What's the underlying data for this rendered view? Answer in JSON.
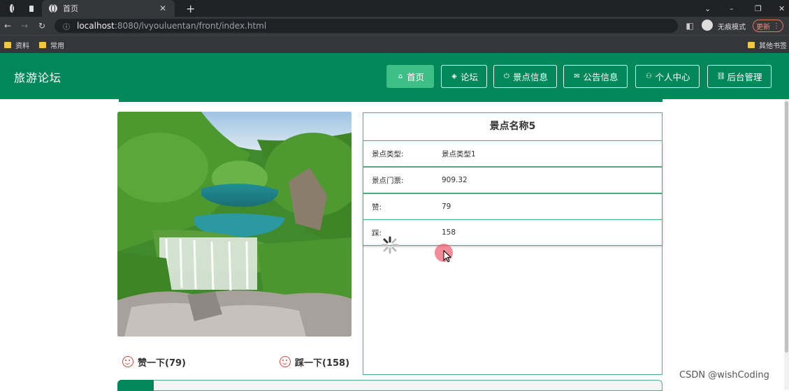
{
  "browser": {
    "tab_title": "首页",
    "url_host": "localhost",
    "url_path": ":8080/lvyouluentan/front/index.html",
    "profile_label": "无痕模式",
    "update_label": "更新",
    "bookmarks": [
      "资料",
      "常用"
    ],
    "other_bookmarks": "其他书签"
  },
  "site": {
    "title": "旅游论坛",
    "nav": [
      {
        "label": "首页",
        "icon": "home-icon",
        "active": true
      },
      {
        "label": "论坛",
        "icon": "layers-icon",
        "active": false
      },
      {
        "label": "景点信息",
        "icon": "power-icon",
        "active": false
      },
      {
        "label": "公告信息",
        "icon": "mail-icon",
        "active": false
      },
      {
        "label": "个人中心",
        "icon": "user-icon",
        "active": false
      },
      {
        "label": "后台管理",
        "icon": "link-icon",
        "active": false
      }
    ]
  },
  "detail": {
    "name": "景点名称5",
    "rows": [
      {
        "key": "景点类型:",
        "value": "景点类型1"
      },
      {
        "key": "景点门票:",
        "value": "909.32"
      },
      {
        "key": "赞:",
        "value": "79"
      },
      {
        "key": "踩:",
        "value": "158"
      }
    ],
    "like_label": "赞一下(79)",
    "dislike_label": "踩一下(158)"
  },
  "watermark": "CSDN @wishCoding",
  "colors": {
    "primary": "#00875a",
    "active_nav": "#3ebf85",
    "border": "#4caf84",
    "vote_icon": "#d9443a"
  }
}
